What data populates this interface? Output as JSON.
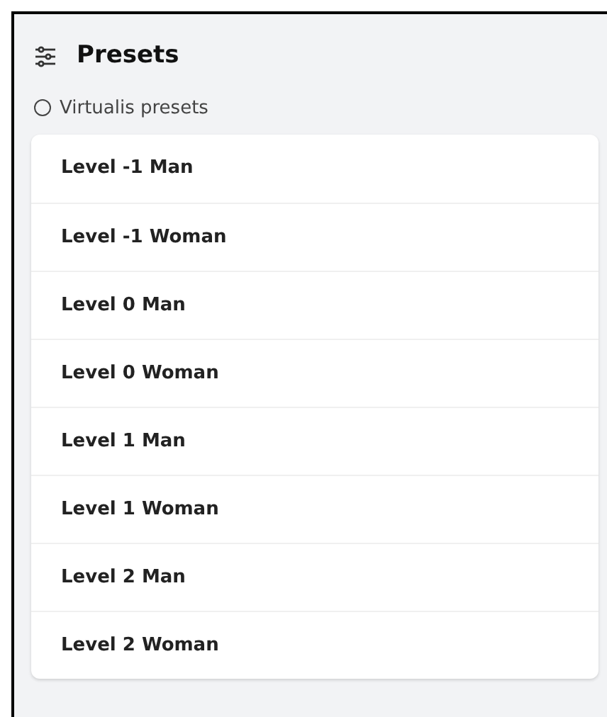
{
  "panel": {
    "title": "Presets"
  },
  "group": {
    "label": "Virtualis presets",
    "selected": false
  },
  "presets": [
    {
      "label": "Level -1 Man"
    },
    {
      "label": "Level -1 Woman"
    },
    {
      "label": "Level 0 Man"
    },
    {
      "label": "Level 0 Woman"
    },
    {
      "label": "Level 1 Man"
    },
    {
      "label": "Level 1 Woman"
    },
    {
      "label": "Level 2 Man"
    },
    {
      "label": "Level 2 Woman"
    }
  ]
}
